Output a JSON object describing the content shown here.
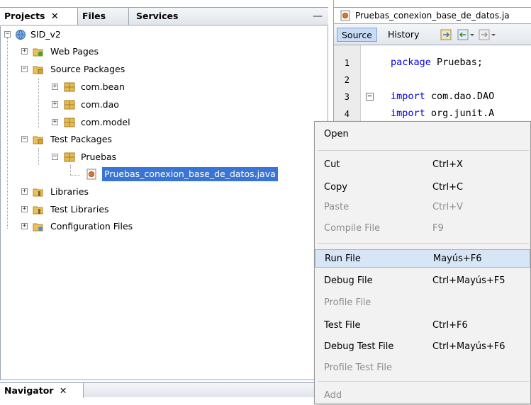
{
  "projects_panel": {
    "tabs": [
      {
        "label": "Projects",
        "close": "✕"
      },
      {
        "label": "Files"
      },
      {
        "label": "Services"
      }
    ],
    "minimize": "—",
    "tree": {
      "root": "SID_v2",
      "web_pages": "Web Pages",
      "source_packages": "Source Packages",
      "pkg_bean": "com.bean",
      "pkg_dao": "com.dao",
      "pkg_model": "com.model",
      "test_packages": "Test Packages",
      "pkg_pruebas": "Pruebas",
      "selected_file": "Pruebas_conexion_base_de_datos.java",
      "libraries": "Libraries",
      "test_libraries": "Test Libraries",
      "configuration_files": "Configuration Files"
    }
  },
  "navigator": {
    "label": "Navigator",
    "close": "✕"
  },
  "editor": {
    "tab_title": "Pruebas_conexion_base_de_datos.ja",
    "source_label": "Source",
    "history_label": "History",
    "line_numbers": [
      "1",
      "2",
      "3",
      "4"
    ],
    "line1_kw": "package",
    "line1_rest": " Pruebas;",
    "line3_kw": "import",
    "line3_rest": " com.dao.DAO",
    "line4_kw": "import",
    "line4_rest": " org.junit.A"
  },
  "context_menu": {
    "open": "Open",
    "cut": "Cut",
    "cut_sc": "Ctrl+X",
    "copy": "Copy",
    "copy_sc": "Ctrl+C",
    "paste": "Paste",
    "paste_sc": "Ctrl+V",
    "compile": "Compile File",
    "compile_sc": "F9",
    "run": "Run File",
    "run_sc": "Mayús+F6",
    "debug": "Debug File",
    "debug_sc": "Ctrl+Mayús+F5",
    "profile": "Profile File",
    "test": "Test File",
    "test_sc": "Ctrl+F6",
    "debug_test": "Debug Test File",
    "debug_test_sc": "Ctrl+Mayús+F6",
    "profile_test": "Profile Test File",
    "add": "Add"
  },
  "colors": {
    "selection": "#3875d7",
    "keyword": "#0000e6",
    "menu_highlight": "#d6e6f6"
  }
}
